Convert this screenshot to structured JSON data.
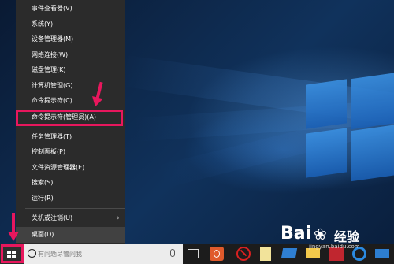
{
  "context_menu": {
    "items": [
      "事件查看器(V)",
      "系统(Y)",
      "设备管理器(M)",
      "网络连接(W)",
      "磁盘管理(K)",
      "计算机管理(G)",
      "命令提示符(C)",
      "命令提示符(管理员)(A)",
      "任务管理器(T)",
      "控制面板(P)",
      "文件资源管理器(E)",
      "搜索(S)",
      "运行(R)",
      "关机或注销(U)",
      "桌面(D)"
    ],
    "selected_item": "命令提示符(管理员)(A)"
  },
  "taskbar": {
    "search_placeholder": "有问题尽管问我",
    "icons": [
      "start-icon",
      "search-icon",
      "microphone-icon",
      "task-view-icon",
      "app-orange-icon",
      "stop-icon",
      "notepad-icon",
      "monitor-icon",
      "folder-icon",
      "media-icon",
      "edge-icon",
      "mail-icon"
    ]
  },
  "watermark": {
    "brand": "Bai",
    "brand_cn": "经验",
    "url": "jingyan.baidu.com"
  },
  "colors": {
    "highlight": "#e8175d",
    "menu_bg": "#2b2b2b",
    "taskbar_bg": "#1c1c1c"
  }
}
